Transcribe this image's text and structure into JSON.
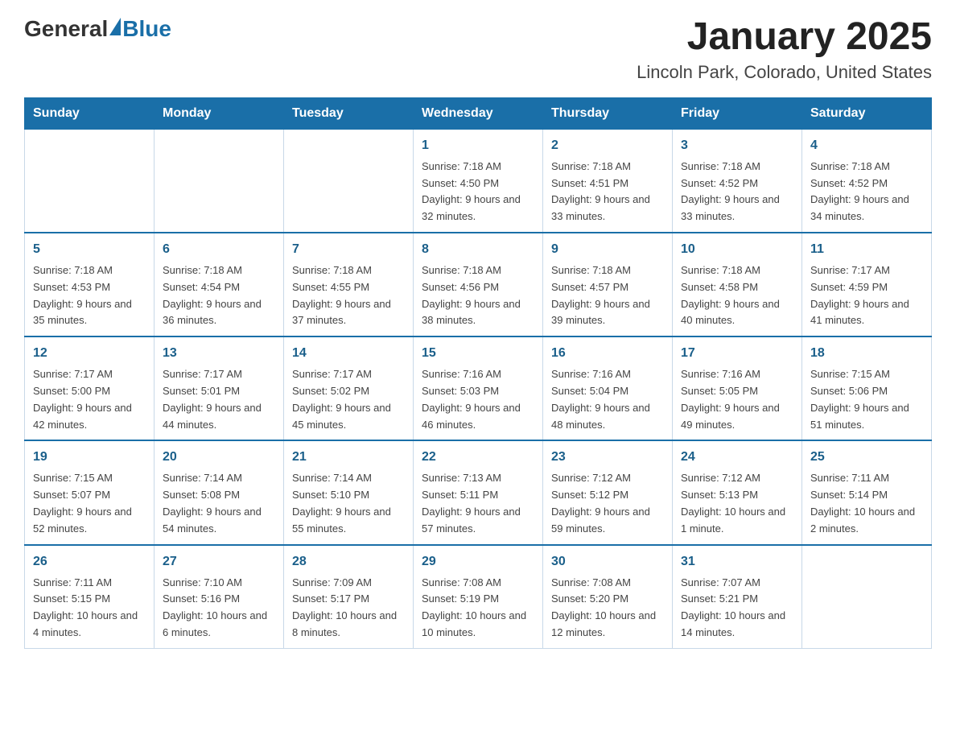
{
  "logo": {
    "text_general": "General",
    "text_blue": "Blue"
  },
  "title": "January 2025",
  "subtitle": "Lincoln Park, Colorado, United States",
  "days_of_week": [
    "Sunday",
    "Monday",
    "Tuesday",
    "Wednesday",
    "Thursday",
    "Friday",
    "Saturday"
  ],
  "weeks": [
    [
      {
        "day": "",
        "sunrise": "",
        "sunset": "",
        "daylight": ""
      },
      {
        "day": "",
        "sunrise": "",
        "sunset": "",
        "daylight": ""
      },
      {
        "day": "",
        "sunrise": "",
        "sunset": "",
        "daylight": ""
      },
      {
        "day": "1",
        "sunrise": "Sunrise: 7:18 AM",
        "sunset": "Sunset: 4:50 PM",
        "daylight": "Daylight: 9 hours and 32 minutes."
      },
      {
        "day": "2",
        "sunrise": "Sunrise: 7:18 AM",
        "sunset": "Sunset: 4:51 PM",
        "daylight": "Daylight: 9 hours and 33 minutes."
      },
      {
        "day": "3",
        "sunrise": "Sunrise: 7:18 AM",
        "sunset": "Sunset: 4:52 PM",
        "daylight": "Daylight: 9 hours and 33 minutes."
      },
      {
        "day": "4",
        "sunrise": "Sunrise: 7:18 AM",
        "sunset": "Sunset: 4:52 PM",
        "daylight": "Daylight: 9 hours and 34 minutes."
      }
    ],
    [
      {
        "day": "5",
        "sunrise": "Sunrise: 7:18 AM",
        "sunset": "Sunset: 4:53 PM",
        "daylight": "Daylight: 9 hours and 35 minutes."
      },
      {
        "day": "6",
        "sunrise": "Sunrise: 7:18 AM",
        "sunset": "Sunset: 4:54 PM",
        "daylight": "Daylight: 9 hours and 36 minutes."
      },
      {
        "day": "7",
        "sunrise": "Sunrise: 7:18 AM",
        "sunset": "Sunset: 4:55 PM",
        "daylight": "Daylight: 9 hours and 37 minutes."
      },
      {
        "day": "8",
        "sunrise": "Sunrise: 7:18 AM",
        "sunset": "Sunset: 4:56 PM",
        "daylight": "Daylight: 9 hours and 38 minutes."
      },
      {
        "day": "9",
        "sunrise": "Sunrise: 7:18 AM",
        "sunset": "Sunset: 4:57 PM",
        "daylight": "Daylight: 9 hours and 39 minutes."
      },
      {
        "day": "10",
        "sunrise": "Sunrise: 7:18 AM",
        "sunset": "Sunset: 4:58 PM",
        "daylight": "Daylight: 9 hours and 40 minutes."
      },
      {
        "day": "11",
        "sunrise": "Sunrise: 7:17 AM",
        "sunset": "Sunset: 4:59 PM",
        "daylight": "Daylight: 9 hours and 41 minutes."
      }
    ],
    [
      {
        "day": "12",
        "sunrise": "Sunrise: 7:17 AM",
        "sunset": "Sunset: 5:00 PM",
        "daylight": "Daylight: 9 hours and 42 minutes."
      },
      {
        "day": "13",
        "sunrise": "Sunrise: 7:17 AM",
        "sunset": "Sunset: 5:01 PM",
        "daylight": "Daylight: 9 hours and 44 minutes."
      },
      {
        "day": "14",
        "sunrise": "Sunrise: 7:17 AM",
        "sunset": "Sunset: 5:02 PM",
        "daylight": "Daylight: 9 hours and 45 minutes."
      },
      {
        "day": "15",
        "sunrise": "Sunrise: 7:16 AM",
        "sunset": "Sunset: 5:03 PM",
        "daylight": "Daylight: 9 hours and 46 minutes."
      },
      {
        "day": "16",
        "sunrise": "Sunrise: 7:16 AM",
        "sunset": "Sunset: 5:04 PM",
        "daylight": "Daylight: 9 hours and 48 minutes."
      },
      {
        "day": "17",
        "sunrise": "Sunrise: 7:16 AM",
        "sunset": "Sunset: 5:05 PM",
        "daylight": "Daylight: 9 hours and 49 minutes."
      },
      {
        "day": "18",
        "sunrise": "Sunrise: 7:15 AM",
        "sunset": "Sunset: 5:06 PM",
        "daylight": "Daylight: 9 hours and 51 minutes."
      }
    ],
    [
      {
        "day": "19",
        "sunrise": "Sunrise: 7:15 AM",
        "sunset": "Sunset: 5:07 PM",
        "daylight": "Daylight: 9 hours and 52 minutes."
      },
      {
        "day": "20",
        "sunrise": "Sunrise: 7:14 AM",
        "sunset": "Sunset: 5:08 PM",
        "daylight": "Daylight: 9 hours and 54 minutes."
      },
      {
        "day": "21",
        "sunrise": "Sunrise: 7:14 AM",
        "sunset": "Sunset: 5:10 PM",
        "daylight": "Daylight: 9 hours and 55 minutes."
      },
      {
        "day": "22",
        "sunrise": "Sunrise: 7:13 AM",
        "sunset": "Sunset: 5:11 PM",
        "daylight": "Daylight: 9 hours and 57 minutes."
      },
      {
        "day": "23",
        "sunrise": "Sunrise: 7:12 AM",
        "sunset": "Sunset: 5:12 PM",
        "daylight": "Daylight: 9 hours and 59 minutes."
      },
      {
        "day": "24",
        "sunrise": "Sunrise: 7:12 AM",
        "sunset": "Sunset: 5:13 PM",
        "daylight": "Daylight: 10 hours and 1 minute."
      },
      {
        "day": "25",
        "sunrise": "Sunrise: 7:11 AM",
        "sunset": "Sunset: 5:14 PM",
        "daylight": "Daylight: 10 hours and 2 minutes."
      }
    ],
    [
      {
        "day": "26",
        "sunrise": "Sunrise: 7:11 AM",
        "sunset": "Sunset: 5:15 PM",
        "daylight": "Daylight: 10 hours and 4 minutes."
      },
      {
        "day": "27",
        "sunrise": "Sunrise: 7:10 AM",
        "sunset": "Sunset: 5:16 PM",
        "daylight": "Daylight: 10 hours and 6 minutes."
      },
      {
        "day": "28",
        "sunrise": "Sunrise: 7:09 AM",
        "sunset": "Sunset: 5:17 PM",
        "daylight": "Daylight: 10 hours and 8 minutes."
      },
      {
        "day": "29",
        "sunrise": "Sunrise: 7:08 AM",
        "sunset": "Sunset: 5:19 PM",
        "daylight": "Daylight: 10 hours and 10 minutes."
      },
      {
        "day": "30",
        "sunrise": "Sunrise: 7:08 AM",
        "sunset": "Sunset: 5:20 PM",
        "daylight": "Daylight: 10 hours and 12 minutes."
      },
      {
        "day": "31",
        "sunrise": "Sunrise: 7:07 AM",
        "sunset": "Sunset: 5:21 PM",
        "daylight": "Daylight: 10 hours and 14 minutes."
      },
      {
        "day": "",
        "sunrise": "",
        "sunset": "",
        "daylight": ""
      }
    ]
  ]
}
